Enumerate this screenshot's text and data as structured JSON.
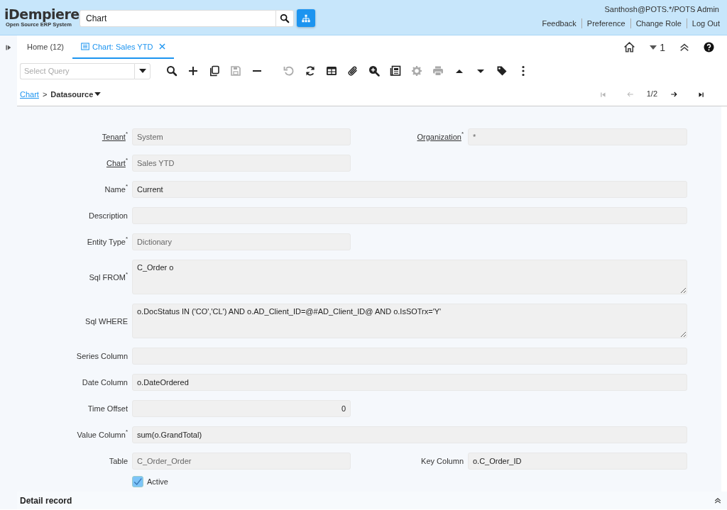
{
  "header": {
    "logo": {
      "title": "iDempiere",
      "subtitle": "Open Source ERP System"
    },
    "search": {
      "value": "Chart"
    },
    "user": "Santhosh@POTS.*/POTS Admin",
    "links": [
      "Feedback",
      "Preference",
      "Change Role",
      "Log Out"
    ]
  },
  "tabs": [
    {
      "label": "Home (12)",
      "selected": false,
      "kind": "home"
    },
    {
      "label": "Chart: Sales YTD",
      "selected": true,
      "kind": "window"
    }
  ],
  "tab_tools": {
    "window_count": "1"
  },
  "toolbar": {
    "query": {
      "placeholder": "Select Query"
    },
    "buttons": [
      {
        "kind": "search",
        "disabled": false
      },
      {
        "kind": "new",
        "disabled": false
      },
      {
        "kind": "copy",
        "disabled": false
      },
      {
        "kind": "save",
        "disabled": true
      },
      {
        "kind": "delete",
        "disabled": false
      },
      {
        "kind": "undo",
        "disabled": true
      },
      {
        "kind": "refresh",
        "disabled": false
      },
      {
        "kind": "grid",
        "disabled": false
      },
      {
        "kind": "attach",
        "disabled": false
      },
      {
        "kind": "zoom",
        "disabled": false
      },
      {
        "kind": "report",
        "disabled": false
      },
      {
        "kind": "process",
        "disabled": true
      },
      {
        "kind": "print",
        "disabled": true
      },
      {
        "kind": "up",
        "disabled": false
      },
      {
        "kind": "down",
        "disabled": false
      },
      {
        "kind": "tag",
        "disabled": false
      },
      {
        "kind": "more",
        "disabled": false
      }
    ]
  },
  "breadcrumb": {
    "link": "Chart",
    "separator": ">",
    "current": "Datasource"
  },
  "record_nav": {
    "position": "1/2",
    "buttons": [
      {
        "kind": "first",
        "disabled": true
      },
      {
        "kind": "prev",
        "disabled": true
      },
      {
        "kind": "next",
        "disabled": false
      },
      {
        "kind": "last",
        "disabled": false
      }
    ]
  },
  "form": {
    "rows": [
      {
        "fields": [
          {
            "label": "Tenant$^{*}$",
            "link": true,
            "value": "System",
            "readonly": true,
            "kind": "short"
          },
          {
            "label": "Organization$^{*}$",
            "link": true,
            "value": "*",
            "readonly": true,
            "kind": "short"
          }
        ]
      },
      {
        "fields": [
          {
            "label": "Chart$^{*}$",
            "link": true,
            "value": "Sales YTD",
            "readonly": true,
            "kind": "short"
          }
        ]
      },
      {
        "fields": [
          {
            "label": "Name$^{*}$",
            "link": false,
            "value": "Current",
            "readonly": false,
            "kind": "long"
          }
        ]
      },
      {
        "fields": [
          {
            "label": "Description",
            "link": false,
            "kind": "long"
          }
        ]
      },
      {
        "fields": [
          {
            "label": "Entity Type$^{*}$",
            "link": false,
            "value": "Dictionary",
            "readonly": true,
            "kind": "short"
          }
        ]
      },
      {
        "fields": [
          {
            "label": "Sql FROM$^{*}$",
            "link": false,
            "value": "C_Order o",
            "readonly": false,
            "kind": "memo"
          }
        ]
      },
      {
        "fields": [
          {
            "label": "Sql WHERE",
            "link": false,
            "value": "o.DocStatus IN ('CO','CL') AND o.AD_Client_ID=@#AD_Client_ID@ AND o.IsSOTrx='Y'",
            "readonly": false,
            "kind": "memo"
          }
        ]
      },
      {
        "fields": [
          {
            "label": "Series Column",
            "link": false,
            "kind": "long"
          }
        ]
      },
      {
        "fields": [
          {
            "label": "Date Column",
            "link": false,
            "value": "o.DateOrdered",
            "readonly": false,
            "kind": "long"
          }
        ]
      },
      {
        "fields": [
          {
            "label": "Time Offset",
            "link": false,
            "value": "0",
            "readonly": false,
            "kind": "number"
          }
        ]
      },
      {
        "fields": [
          {
            "label": "Value Column$^{*}$",
            "link": false,
            "value": "sum(o.GrandTotal)",
            "readonly": false,
            "kind": "long"
          }
        ]
      },
      {
        "fields": [
          {
            "label": "Table",
            "link": false,
            "value": "C_Order_Order",
            "readonly": true,
            "kind": "short"
          },
          {
            "label": "Key Column",
            "link": false,
            "value": "o.C_Order_ID",
            "readonly": false,
            "kind": "short"
          }
        ]
      },
      {
        "fields": [
          {
            "label": "Active",
            "checked": true,
            "kind": "check"
          }
        ]
      }
    ]
  },
  "detail": {
    "title": "Detail record"
  }
}
